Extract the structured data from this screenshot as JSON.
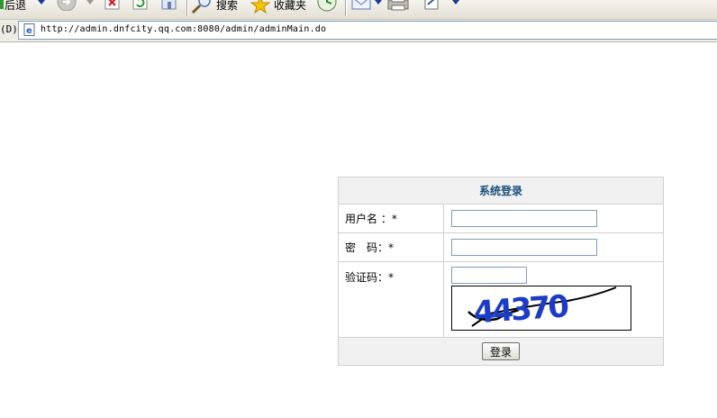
{
  "toolbar": {
    "back_label": "后退",
    "search_label": "搜索",
    "favorites_label": "收藏夹"
  },
  "address_bar": {
    "label": "(D)",
    "url": "http://admin.dnfcity.qq.com:8080/admin/adminMain.do"
  },
  "login": {
    "title": "系统登录",
    "username_label": "用户名 ：*",
    "password_label": "密　码：*",
    "captcha_label": "验证码：*",
    "username_value": "",
    "password_value": "",
    "captcha_value": "",
    "captcha_image_text": "44370",
    "submit_label": "登录"
  },
  "colors": {
    "title_text": "#1a4f7a",
    "header_bg": "#f1f1f1",
    "captcha_ink": "#1c3cc8"
  }
}
